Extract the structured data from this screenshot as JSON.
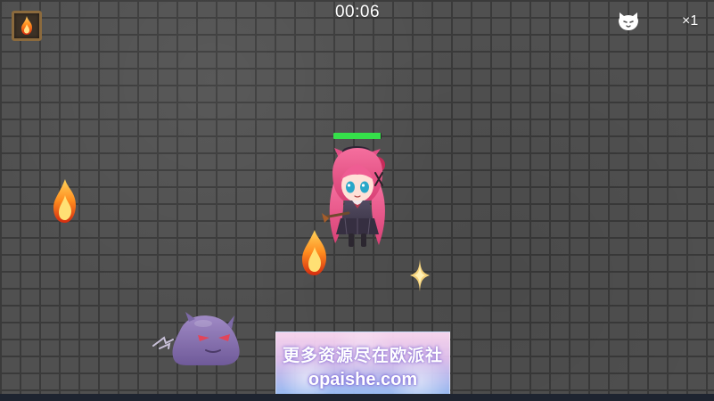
{
  "hud": {
    "timer": "00:06",
    "lives": "×1",
    "skill_icon": "fire-icon",
    "lives_icon": "cat-face-icon"
  },
  "player": {
    "health_fraction": 0.98,
    "health_color": "#35e04a"
  },
  "entities": {
    "flame_icon": "fire-icon",
    "pickup_icon": "sparkle-icon",
    "enemy_icon": "slime-icon"
  },
  "watermark": {
    "line1": "更多资源尽在欧派社",
    "line2": "opaishe.com"
  }
}
